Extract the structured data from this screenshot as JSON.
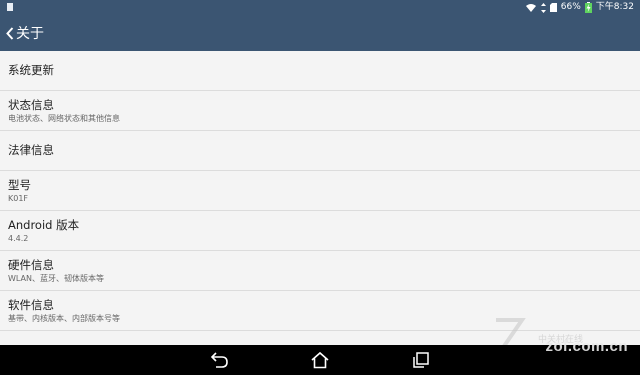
{
  "status_bar": {
    "battery": "66%",
    "time": "下午8:32"
  },
  "app_bar": {
    "title": "关于"
  },
  "items": [
    {
      "title": "系统更新",
      "subtitle": ""
    },
    {
      "title": "状态信息",
      "subtitle": "电池状态、网络状态和其他信息"
    },
    {
      "title": "法律信息",
      "subtitle": ""
    },
    {
      "title": "型号",
      "subtitle": "K01F"
    },
    {
      "title": "Android 版本",
      "subtitle": "4.4.2"
    },
    {
      "title": "硬件信息",
      "subtitle": "WLAN、蓝牙、韧体版本等"
    },
    {
      "title": "软件信息",
      "subtitle": "基带、内核版本、内部版本号等"
    }
  ],
  "nav": {
    "back": "back-icon",
    "home": "home-icon",
    "recents": "recents-icon"
  },
  "watermark": {
    "text": "zol.com.cn",
    "sub": "中关村在线"
  },
  "colors": {
    "app_bar": "#3b5572",
    "background": "#f4f4f4",
    "divider": "#dcdcdc",
    "battery_accent": "#5fd35f"
  }
}
